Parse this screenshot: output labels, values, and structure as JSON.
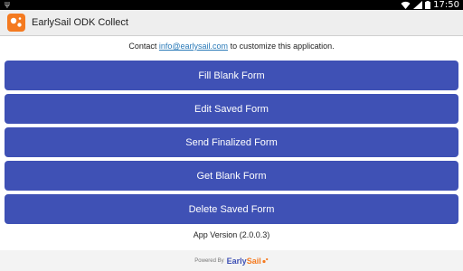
{
  "statusbar": {
    "time": "17:50"
  },
  "app": {
    "title": "EarlySail ODK Collect"
  },
  "contact": {
    "prefix": "Contact ",
    "email": "info@earlysail.com",
    "suffix": " to customize this application."
  },
  "buttons": [
    {
      "label": "Fill Blank Form"
    },
    {
      "label": "Edit Saved Form"
    },
    {
      "label": "Send Finalized Form"
    },
    {
      "label": "Get Blank Form"
    },
    {
      "label": "Delete Saved Form"
    }
  ],
  "version": "App Version (2.0.0.3)",
  "footer": {
    "powered_by": "Powered By",
    "brand_early": "Early",
    "brand_sail": "Sail"
  },
  "colors": {
    "primary": "#3f51b5",
    "accent": "#f47a20",
    "link": "#2a7ab8"
  }
}
